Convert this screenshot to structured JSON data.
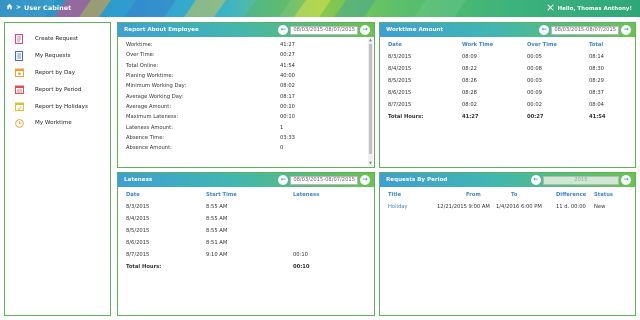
{
  "topbar": {
    "title": "User Cabinet",
    "greeting": "Hello, Thomas Anthony!"
  },
  "sidebar": {
    "items": [
      {
        "label": "Create Request",
        "icon": "form-icon",
        "color": "#e0457b"
      },
      {
        "label": "My Requests",
        "icon": "list-icon",
        "color": "#3a6fc4"
      },
      {
        "label": "Report by Day",
        "icon": "calendar-day-icon",
        "color": "#f0a030"
      },
      {
        "label": "Report by Period",
        "icon": "calendar-period-icon",
        "color": "#e05050"
      },
      {
        "label": "Report by Holidays",
        "icon": "holiday-icon",
        "color": "#e0c030"
      },
      {
        "label": "My Worktime",
        "icon": "clock-icon",
        "color": "#f0a030"
      }
    ]
  },
  "report": {
    "title": "Report About Employee",
    "date_range": "08/03/2015-08/07/2015",
    "rows": [
      {
        "label": "Worktime:",
        "value": "41:27"
      },
      {
        "label": "Over Time:",
        "value": "00:27"
      },
      {
        "label": "Total Online:",
        "value": "41:54"
      },
      {
        "label": "Planing Worktime:",
        "value": "40:00"
      },
      {
        "label": "Minimum Working Day:",
        "value": "08:02"
      },
      {
        "label": "Average Working Day:",
        "value": "08:17"
      },
      {
        "label": "Average Amount:",
        "value": "00:10"
      },
      {
        "label": "Maximum Lateness:",
        "value": "00:10"
      },
      {
        "label": "Lateness Amount:",
        "value": "1"
      },
      {
        "label": "Absence Time:",
        "value": "03:33"
      },
      {
        "label": "Absence Amount:",
        "value": "0"
      }
    ]
  },
  "worktime": {
    "title": "Worktime Amount",
    "date_range": "08/03/2015-08/07/2015",
    "headers": [
      "Date",
      "Work Time",
      "Over Time",
      "Total"
    ],
    "rows": [
      [
        "8/3/2015",
        "08:09",
        "00:05",
        "08:14"
      ],
      [
        "8/4/2015",
        "08:22",
        "00:08",
        "08:30"
      ],
      [
        "8/5/2015",
        "08:26",
        "00:03",
        "08:29"
      ],
      [
        "8/6/2015",
        "08:28",
        "00:09",
        "08:37"
      ],
      [
        "8/7/2015",
        "08:02",
        "00:02",
        "08:04"
      ]
    ],
    "total": [
      "Total Hours:",
      "41:27",
      "00:27",
      "41:54"
    ]
  },
  "lateness": {
    "title": "Lateness",
    "date_range": "08/03/2015-08/07/2015",
    "headers": [
      "Date",
      "Start Time",
      "Lateness"
    ],
    "rows": [
      [
        "8/3/2015",
        "8:55 AM",
        ""
      ],
      [
        "8/4/2015",
        "8:55 AM",
        ""
      ],
      [
        "8/5/2015",
        "8:55 AM",
        ""
      ],
      [
        "8/6/2015",
        "8:51 AM",
        ""
      ],
      [
        "8/7/2015",
        "9:10 AM",
        "00:10"
      ]
    ],
    "total": [
      "Total Hours:",
      "",
      "00:10"
    ]
  },
  "requests": {
    "title": "Requests By Period",
    "year": "2015",
    "headers": [
      "Title",
      "From",
      "To",
      "Difference",
      "Status"
    ],
    "rows": [
      [
        "Holiday",
        "12/21/2015 9:00 AM",
        "1/4/2016 6:00 PM",
        "11 d. 00:00",
        "New"
      ]
    ]
  }
}
